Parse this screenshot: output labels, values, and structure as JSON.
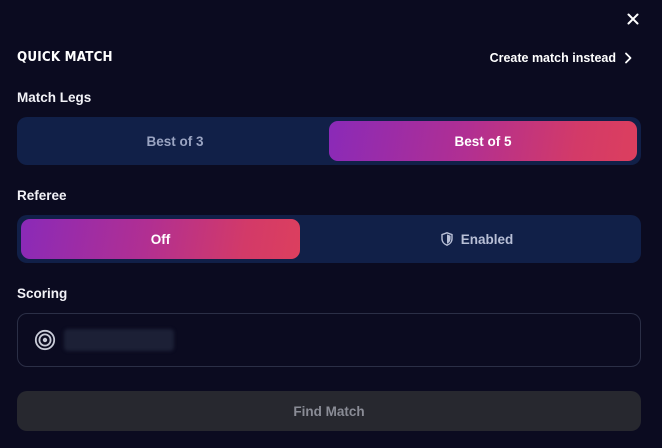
{
  "header": {
    "title": "QUICK MATCH",
    "create_link_label": "Create match instead"
  },
  "match_legs": {
    "label": "Match Legs",
    "options": [
      {
        "label": "Best of 3",
        "selected": false
      },
      {
        "label": "Best of 5",
        "selected": true
      }
    ]
  },
  "referee": {
    "label": "Referee",
    "options": [
      {
        "label": "Off",
        "selected": true
      },
      {
        "label": "Enabled",
        "selected": false,
        "icon": "shield-icon"
      }
    ]
  },
  "scoring": {
    "label": "Scoring",
    "icon": "target-icon",
    "value": ""
  },
  "actions": {
    "find_match_label": "Find Match"
  },
  "colors": {
    "background": "#0b0b20",
    "segment_bg": "#112048",
    "accent_start": "#8a2ab8",
    "accent_end": "#dc3f5e",
    "button_disabled_bg": "#27282f",
    "button_disabled_text": "#8a8c96"
  }
}
